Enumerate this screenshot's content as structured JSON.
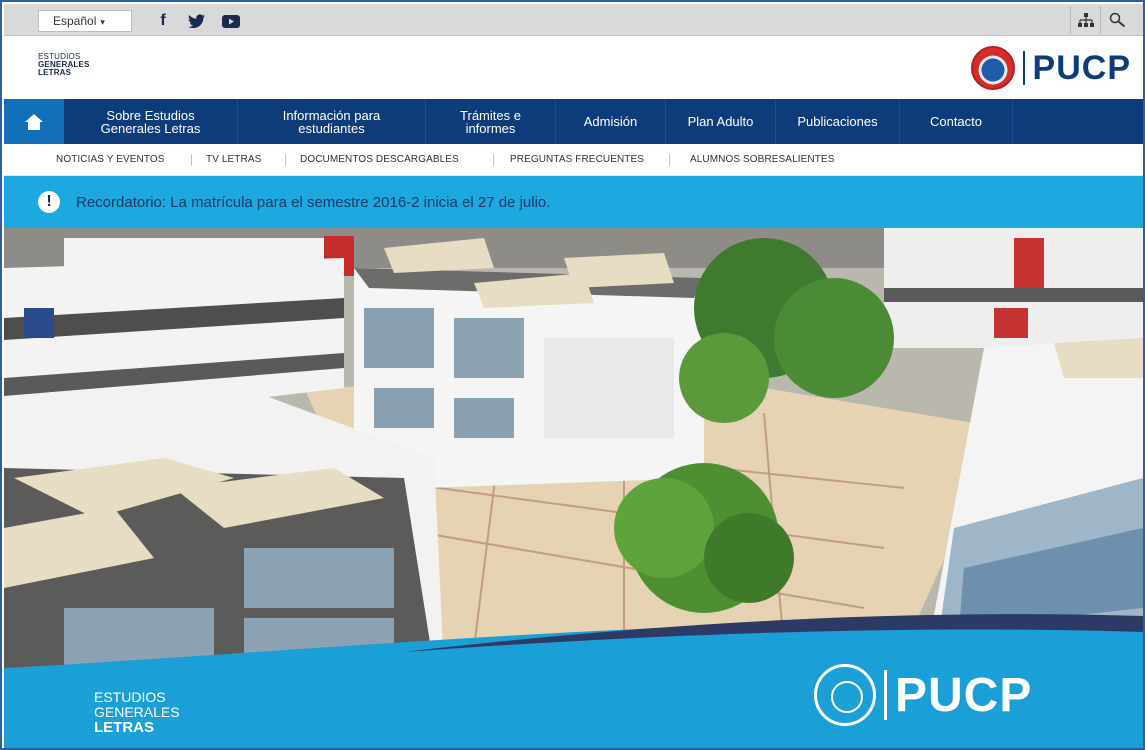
{
  "topbar": {
    "language_label": "Español",
    "social": [
      "facebook-icon",
      "twitter-icon",
      "youtube-icon"
    ],
    "tools": [
      "sitemap-icon",
      "search-icon"
    ]
  },
  "header": {
    "logo_lines": [
      "ESTUDIOS",
      "GENERALES",
      "LETRAS"
    ],
    "brand": "PUCP"
  },
  "nav": {
    "items": [
      "Sobre Estudios Generales Letras",
      "Información para estudiantes",
      "Trámites e informes",
      "Admisión",
      "Plan Adulto",
      "Publicaciones",
      "Contacto"
    ]
  },
  "subnav": {
    "items": [
      "NOTICIAS Y EVENTOS",
      "TV LETRAS",
      "DOCUMENTOS DESCARGABLES",
      "PREGUNTAS FRECUENTES",
      "ALUMNOS SOBRESALIENTES"
    ]
  },
  "alert": {
    "message": "Recordatorio: La matrícula para el semestre 2016-2 inicia el 27 de julio."
  },
  "footer": {
    "logo_lines": [
      "ESTUDIOS",
      "GENERALES",
      "LETRAS"
    ],
    "brand": "PUCP"
  },
  "colors": {
    "nav_bg": "#0e3c7a",
    "home_bg": "#1270b8",
    "alert_bg": "#1da8df",
    "footer_bg": "#1a9fd6"
  }
}
